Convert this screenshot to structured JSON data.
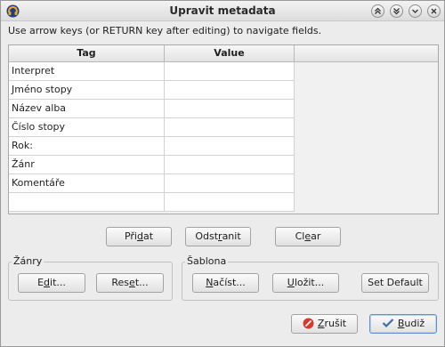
{
  "window": {
    "title": "Upravit metadata"
  },
  "hint": "Use arrow keys (or RETURN key after editing) to navigate fields.",
  "table": {
    "headers": [
      "Tag",
      "Value"
    ],
    "rows": [
      {
        "tag": "Interpret",
        "value": ""
      },
      {
        "tag": "Jméno stopy",
        "value": ""
      },
      {
        "tag": "Název alba",
        "value": ""
      },
      {
        "tag": "Číslo stopy",
        "value": ""
      },
      {
        "tag": "Rok:",
        "value": ""
      },
      {
        "tag": "Žánr",
        "value": ""
      },
      {
        "tag": "Komentáře",
        "value": ""
      },
      {
        "tag": "",
        "value": ""
      }
    ]
  },
  "row_buttons": {
    "add": {
      "pre": "Při",
      "acc": "d",
      "post": "at"
    },
    "remove": {
      "pre": "Odst",
      "acc": "r",
      "post": "anit"
    },
    "clear": {
      "pre": "Cl",
      "acc": "e",
      "post": "ar"
    }
  },
  "genres": {
    "label": "Žánry",
    "edit": {
      "pre": "E",
      "acc": "d",
      "post": "it..."
    },
    "reset": {
      "pre": "Res",
      "acc": "e",
      "post": "t..."
    }
  },
  "template": {
    "label": "Šablona",
    "load": {
      "pre": "",
      "acc": "N",
      "post": "ačíst..."
    },
    "save": {
      "pre": "",
      "acc": "U",
      "post": "ložit..."
    },
    "set_default": "Set Default"
  },
  "footer": {
    "cancel": {
      "pre": "",
      "acc": "Z",
      "post": "rušit"
    },
    "ok": {
      "pre": "",
      "acc": "B",
      "post": "udiž"
    }
  },
  "colors": {
    "cancel_icon": "#d9382b",
    "ok_icon": "#3a6ea5",
    "accent_border": "#5c8fcc"
  }
}
